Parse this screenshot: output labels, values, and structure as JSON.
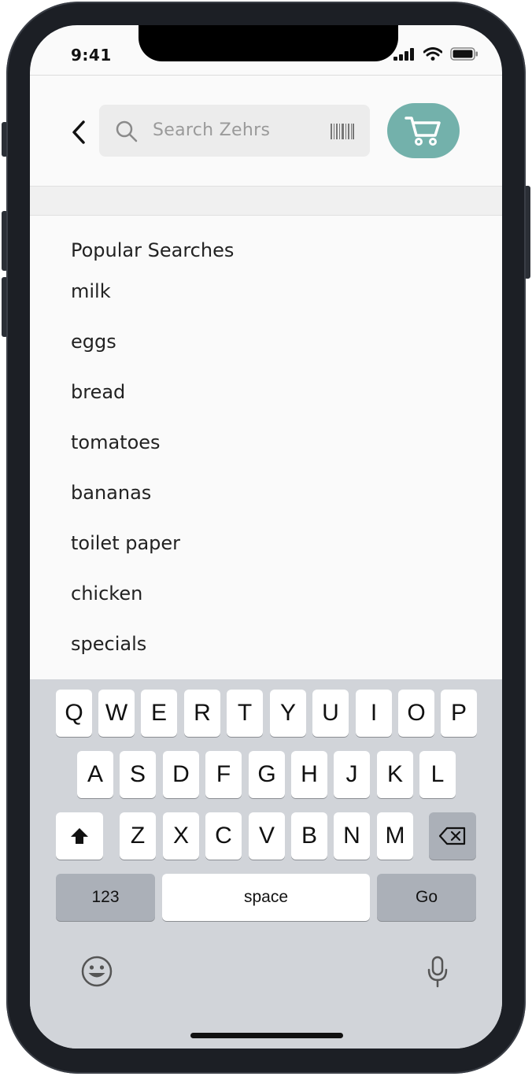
{
  "status_bar": {
    "time": "9:41"
  },
  "header": {
    "search_placeholder": "Search Zehrs"
  },
  "popular": {
    "title": "Popular Searches",
    "items": [
      "milk",
      "eggs",
      "bread",
      "tomatoes",
      "bananas",
      "toilet paper",
      "chicken",
      "specials"
    ]
  },
  "keyboard": {
    "row1": [
      "Q",
      "W",
      "E",
      "R",
      "T",
      "Y",
      "U",
      "I",
      "O",
      "P"
    ],
    "row2": [
      "A",
      "S",
      "D",
      "F",
      "G",
      "H",
      "J",
      "K",
      "L"
    ],
    "row3": [
      "Z",
      "X",
      "C",
      "V",
      "B",
      "N",
      "M"
    ],
    "numbers_label": "123",
    "space_label": "space",
    "go_label": "Go"
  },
  "colors": {
    "accent": "#73b1ab",
    "keyboard_bg": "#d1d4d9"
  },
  "icons": {
    "back": "chevron-left-icon",
    "search": "search-icon",
    "barcode": "barcode-icon",
    "cart": "cart-icon",
    "shift": "shift-icon",
    "delete": "delete-icon",
    "emoji": "emoji-icon",
    "mic": "microphone-icon"
  }
}
